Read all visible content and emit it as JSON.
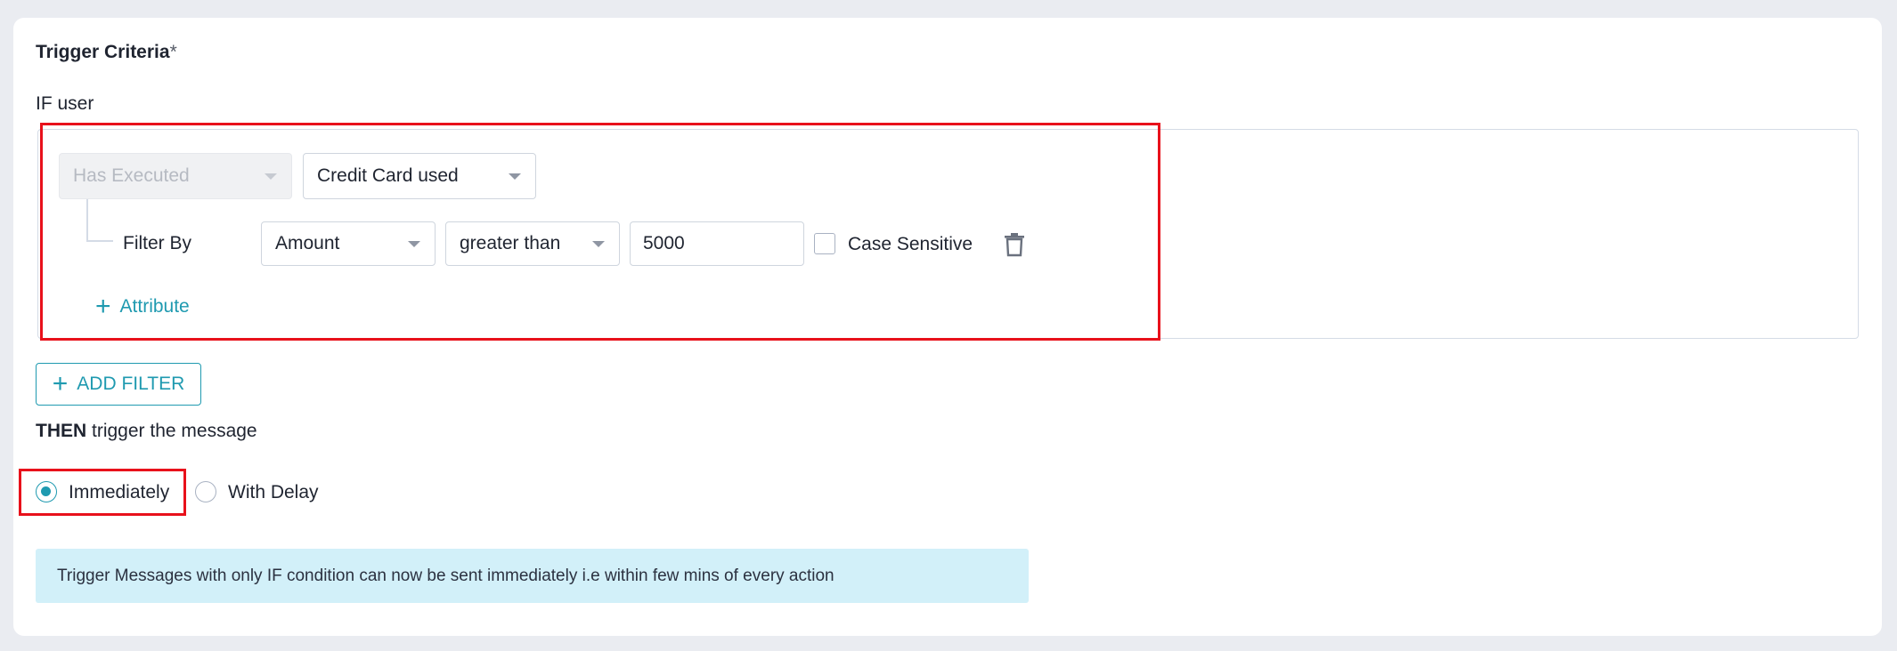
{
  "trigger": {
    "title": "Trigger Criteria",
    "required_mark": "*",
    "if_label": "IF user",
    "condition_select": {
      "value": "Has Executed"
    },
    "event_select": {
      "value": "Credit Card used"
    },
    "filter": {
      "label": "Filter By",
      "attribute": "Amount",
      "operator": "greater than",
      "value": "5000",
      "case_sensitive_label": "Case Sensitive",
      "case_sensitive_checked": false
    },
    "add_attribute_label": "Attribute",
    "add_filter_label": "ADD FILTER"
  },
  "then": {
    "label_bold": "THEN",
    "label_rest": " trigger the message",
    "options": [
      {
        "label": "Immediately",
        "checked": true
      },
      {
        "label": "With Delay",
        "checked": false
      }
    ]
  },
  "info_banner": "Trigger Messages with only IF condition can now be sent immediately i.e within few mins of every action",
  "colors": {
    "accent": "#1f9ab0",
    "highlight": "#e8111b",
    "banner_bg": "#d2f0f9"
  }
}
